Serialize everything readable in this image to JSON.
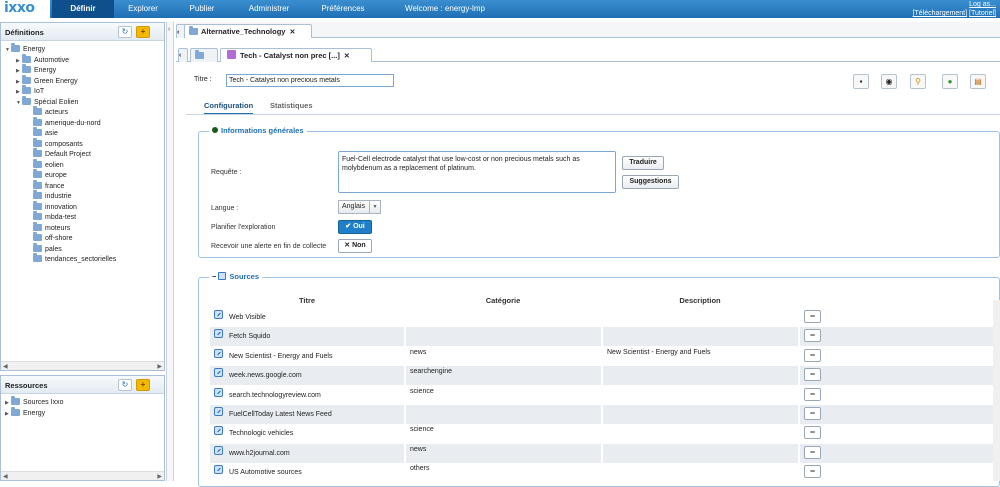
{
  "app": {
    "logo": "ixxo"
  },
  "nav": {
    "tabs": [
      "Définir",
      "Explorer",
      "Publier",
      "Administrer",
      "Préférences"
    ],
    "welcome": "Welcome : energy-lmp",
    "login_link": "Log as...",
    "download_link": "[Téléchargement]",
    "tutorial_link": "[Tutoriel]"
  },
  "definitions": {
    "title": "Définitions",
    "tree": [
      {
        "label": "Energy",
        "level": 0,
        "expanded": true
      },
      {
        "label": "Automotive",
        "level": 1
      },
      {
        "label": "Energy",
        "level": 1
      },
      {
        "label": "Green Energy",
        "level": 1
      },
      {
        "label": "IoT",
        "level": 1
      },
      {
        "label": "Spécial Eolien",
        "level": 1,
        "expanded": true
      },
      {
        "label": "acteurs",
        "level": 2
      },
      {
        "label": "amerique-du-nord",
        "level": 2
      },
      {
        "label": "asie",
        "level": 2
      },
      {
        "label": "composants",
        "level": 2
      },
      {
        "label": "Default Project",
        "level": 2
      },
      {
        "label": "eolien",
        "level": 2
      },
      {
        "label": "europe",
        "level": 2
      },
      {
        "label": "france",
        "level": 2
      },
      {
        "label": "industrie",
        "level": 2
      },
      {
        "label": "innovation",
        "level": 2
      },
      {
        "label": "mbda-test",
        "level": 2
      },
      {
        "label": "moteurs",
        "level": 2
      },
      {
        "label": "off-shore",
        "level": 2
      },
      {
        "label": "pales",
        "level": 2
      },
      {
        "label": "tendances_sectorielles",
        "level": 2
      }
    ]
  },
  "resources": {
    "title": "Ressources",
    "tree": [
      {
        "label": "Sources Ixxo",
        "level": 0
      },
      {
        "label": "Energy",
        "level": 0
      }
    ]
  },
  "doc_tabs": {
    "outer": "Alternative_Technology",
    "inner": "Tech - Catalyst non prec [...]"
  },
  "form": {
    "title_label": "Titre :",
    "title_value": "Tech - Catalyst non precious metals",
    "subtabs": [
      "Configuration",
      "Statistiques"
    ],
    "general": {
      "legend": "Informations générales",
      "request_label": "Requête :",
      "request_value": "Fuel-Cell electrode catalyst that use low-cost or non precious metals such as molybdenum as a replacement of platinum.",
      "translate_button": "Traduire",
      "suggestions_button": "Suggestions",
      "language_label": "Langue :",
      "language_value": "Anglais",
      "schedule_label": "Planifier l'exploration",
      "schedule_value": "Oui",
      "alert_label": "Recevoir une alerte en fin de collecte",
      "alert_value": "Non"
    },
    "sources": {
      "legend": "Sources",
      "headers": [
        "Titre",
        "Catégorie",
        "Description"
      ],
      "rows": [
        {
          "title": "Web Visible",
          "category": "",
          "description": ""
        },
        {
          "title": "Fetch Squido",
          "category": "",
          "description": ""
        },
        {
          "title": "New Scientist - Energy and Fuels",
          "category": "news",
          "description": "New Scientist - Energy and Fuels"
        },
        {
          "title": "week.news.google.com",
          "category": "searchengine",
          "description": ""
        },
        {
          "title": "search.technologyreview.com",
          "category": "science",
          "description": ""
        },
        {
          "title": "FuelCellToday Latest News Feed",
          "category": "",
          "description": ""
        },
        {
          "title": "Technologic vehicles",
          "category": "science",
          "description": ""
        },
        {
          "title": "www.h2journal.com",
          "category": "news",
          "description": ""
        },
        {
          "title": "US Automotive sources",
          "category": "others",
          "description": ""
        }
      ]
    }
  }
}
